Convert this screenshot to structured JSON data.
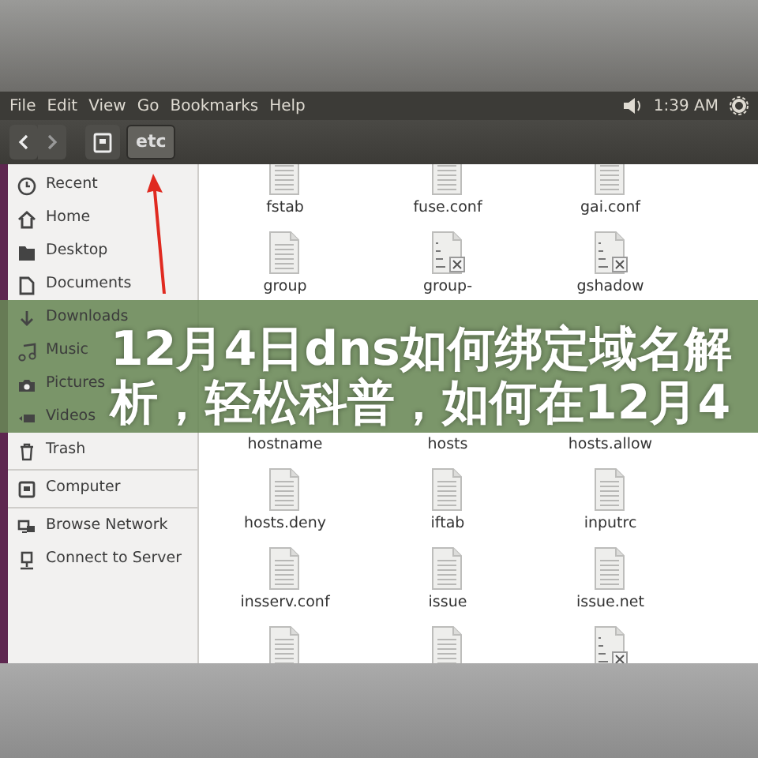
{
  "menu_bar": {
    "menus": [
      "File",
      "Edit",
      "View",
      "Go",
      "Bookmarks",
      "Help"
    ],
    "clock": "1:39 AM"
  },
  "toolbar": {
    "path": [
      {
        "label": "etc",
        "selected": true
      }
    ]
  },
  "sidebar": {
    "sections": [
      [
        {
          "label": "Recent"
        },
        {
          "label": "Home"
        },
        {
          "label": "Desktop"
        },
        {
          "label": "Documents"
        },
        {
          "label": "Downloads"
        },
        {
          "label": "Music"
        },
        {
          "label": "Pictures"
        },
        {
          "label": "Videos"
        },
        {
          "label": "Trash"
        }
      ],
      [
        {
          "label": "Computer"
        }
      ],
      [
        {
          "label": "Browse Network"
        },
        {
          "label": "Connect to Server"
        }
      ]
    ]
  },
  "files": [
    {
      "name": "fstab",
      "kind": "text"
    },
    {
      "name": "fuse.conf",
      "kind": "text"
    },
    {
      "name": "gai.conf",
      "kind": "text"
    },
    {
      "name": "group",
      "kind": "text"
    },
    {
      "name": "group-",
      "kind": "locked"
    },
    {
      "name": "gshadow",
      "kind": "locked"
    },
    {
      "kind": "covered"
    },
    {
      "kind": "covered"
    },
    {
      "kind": "covered"
    },
    {
      "name": "hostname",
      "kind": "covered"
    },
    {
      "name": "hosts",
      "kind": "covered"
    },
    {
      "name": "hosts.allow",
      "kind": "covered"
    },
    {
      "name": "hosts.deny",
      "kind": "text"
    },
    {
      "name": "iftab",
      "kind": "text"
    },
    {
      "name": "inputrc",
      "kind": "text"
    },
    {
      "name": "insserv.conf",
      "kind": "text"
    },
    {
      "name": "issue",
      "kind": "text"
    },
    {
      "name": "issue.net",
      "kind": "text"
    },
    {
      "kind": "text"
    },
    {
      "kind": "text"
    },
    {
      "kind": "locked"
    }
  ],
  "banner": {
    "title": "12月4日dns如何绑定域名解析，轻松科普，如何在12月4"
  }
}
